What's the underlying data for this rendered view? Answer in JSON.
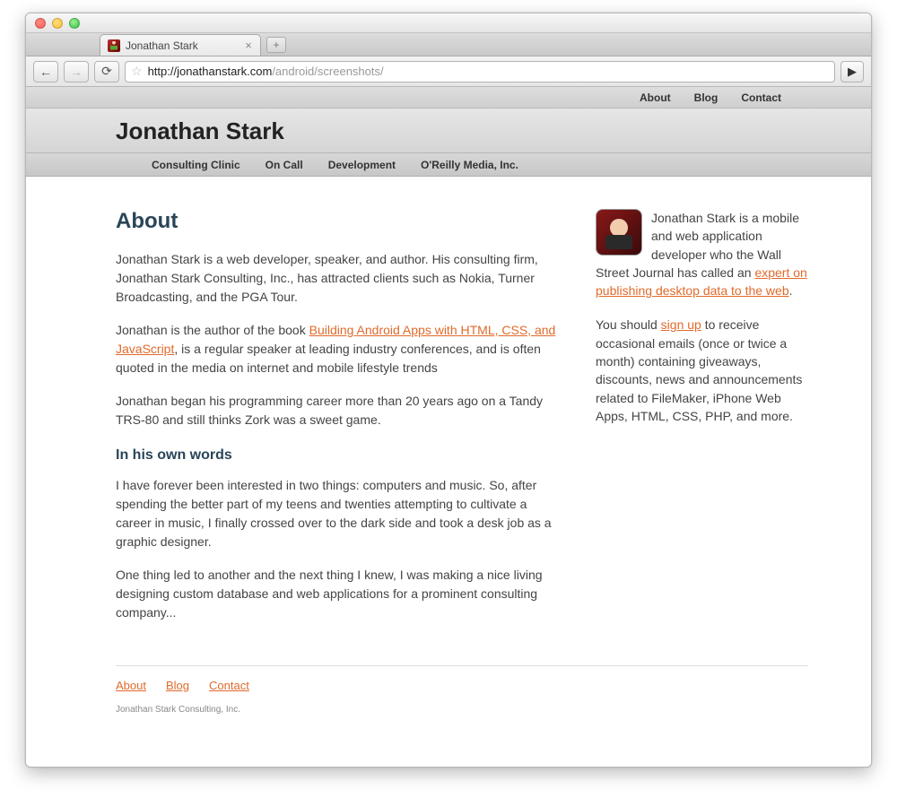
{
  "browser": {
    "tab_title": "Jonathan Stark",
    "url_host": "http://jonathanstark.com",
    "url_path": "/android/screenshots/"
  },
  "topnav": {
    "items": [
      "About",
      "Blog",
      "Contact"
    ]
  },
  "site": {
    "title": "Jonathan Stark"
  },
  "mainnav": {
    "items": [
      "Consulting Clinic",
      "On Call",
      "Development",
      "O'Reilly Media, Inc."
    ]
  },
  "about": {
    "heading": "About",
    "p1": "Jonathan Stark is a web developer, speaker, and author. His consulting firm, Jonathan Stark Consulting, Inc., has attracted clients such as Nokia, Turner Broadcasting, and the PGA Tour.",
    "p2_pre": "Jonathan is the author of the book ",
    "p2_link": "Building Android Apps with HTML, CSS, and JavaScript",
    "p2_post": ", is a regular speaker at leading industry conferences, and is often quoted in the media on internet and mobile lifestyle trends",
    "p3": "Jonathan began his programming career more than 20 years ago on a Tandy TRS-80 and still thinks Zork was a sweet game.",
    "sub_heading": "In his own words",
    "p4": "I have forever been interested in two things: computers and music. So, after spending the better part of my teens and twenties attempting to cultivate a career in music, I finally crossed over to the dark side and took a desk job as a graphic designer.",
    "p5": "One thing led to another and the next thing I knew, I was making a nice living designing custom database and web applications for a prominent consulting company..."
  },
  "sidebar": {
    "bio_pre": "Jonathan Stark is a mobile and web application developer who the Wall Street Journal has called an ",
    "bio_link": "expert on publishing desktop data to the web",
    "bio_post": ".",
    "signup_pre": "You should ",
    "signup_link": "sign up",
    "signup_post": " to receive occasional emails (once or twice a month) containing giveaways, discounts, news and announcements related to FileMaker, iPhone Web Apps, HTML, CSS, PHP, and more."
  },
  "footer": {
    "links": [
      "About",
      "Blog",
      "Contact"
    ],
    "copyright": "Jonathan Stark Consulting, Inc."
  }
}
